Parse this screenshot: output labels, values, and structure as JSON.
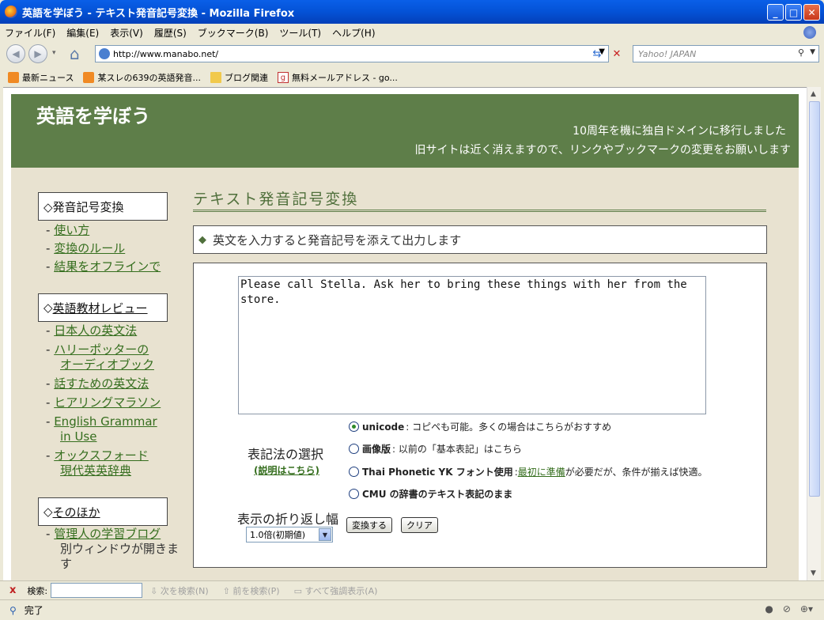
{
  "window": {
    "title": "英語を学ぼう - テキスト発音記号変換 - Mozilla Firefox",
    "controls": [
      "_",
      "□",
      "✕"
    ]
  },
  "menu": [
    "ファイル(F)",
    "編集(E)",
    "表示(V)",
    "履歴(S)",
    "ブックマーク(B)",
    "ツール(T)",
    "ヘルプ(H)"
  ],
  "nav": {
    "url": "http://www.manabo.net/",
    "search_placeholder": "Yahoo! JAPAN"
  },
  "bookmarks": [
    "最新ニュース",
    "某スレの639の英語発音...",
    "ブログ関連",
    "無料メールアドレス - go..."
  ],
  "page": {
    "site_title": "英語を学ぼう",
    "notice_line1": "10周年を機に独自ドメインに移行しました",
    "notice_line2": "旧サイトは近く消えますので、リンクやブックマークの変更をお願いします",
    "sidebar": {
      "section1": "◇発音記号変換",
      "section1_links": [
        "使い方",
        "変換のルール",
        "結果をオフラインで"
      ],
      "section2": "英語教材レビュー",
      "section2_prefix": "◇",
      "section2_links": [
        "日本人の英文法",
        "ハリーポッターの",
        "オーディオブック",
        "話すための英文法",
        "ヒアリングマラソン",
        "English Grammar",
        "in Use",
        "オックスフォード",
        "現代英英辞典"
      ],
      "section3": "そのほか",
      "section3_prefix": "◇",
      "section3_links": [
        "管理人の学習ブログ",
        "別ウィンドウが開きま",
        "す"
      ],
      "bullet": "-"
    },
    "main": {
      "title": "テキスト発音記号変換",
      "intro": "英文を入力すると発音記号を添えて出力します",
      "intro_marker": "◆",
      "textarea_value": "Please call Stella. Ask her to bring these things with her from the\nstore.",
      "notation_heading": "表記法の選択",
      "notation_help": "(説明はこちら)",
      "options": [
        {
          "name": "unicode",
          "desc": ": コピペも可能。多くの場合はこちらがおすすめ",
          "selected": true
        },
        {
          "name": "画像版",
          "desc": ": 以前の「基本表記」はこちら",
          "selected": false
        },
        {
          "name": "Thai Phonetic YK フォント使用",
          "desc": ": ",
          "link": "最初に準備",
          "desc2": "が必要だが、条件が揃えば快適。",
          "selected": false
        },
        {
          "name": "CMU の辞書のテキスト表記のまま",
          "desc": "",
          "selected": false
        }
      ],
      "wrap_heading": "表示の折り返し幅",
      "wrap_value": "1.0倍(初期値)",
      "convert_button": "変換する",
      "clear_button": "クリア"
    }
  },
  "findbar": {
    "close": "x",
    "label": "検索:",
    "next": "次を検索(N)",
    "prev": "前を検索(P)",
    "highlight": "すべて強調表示(A)"
  },
  "status": {
    "text": "完了"
  }
}
